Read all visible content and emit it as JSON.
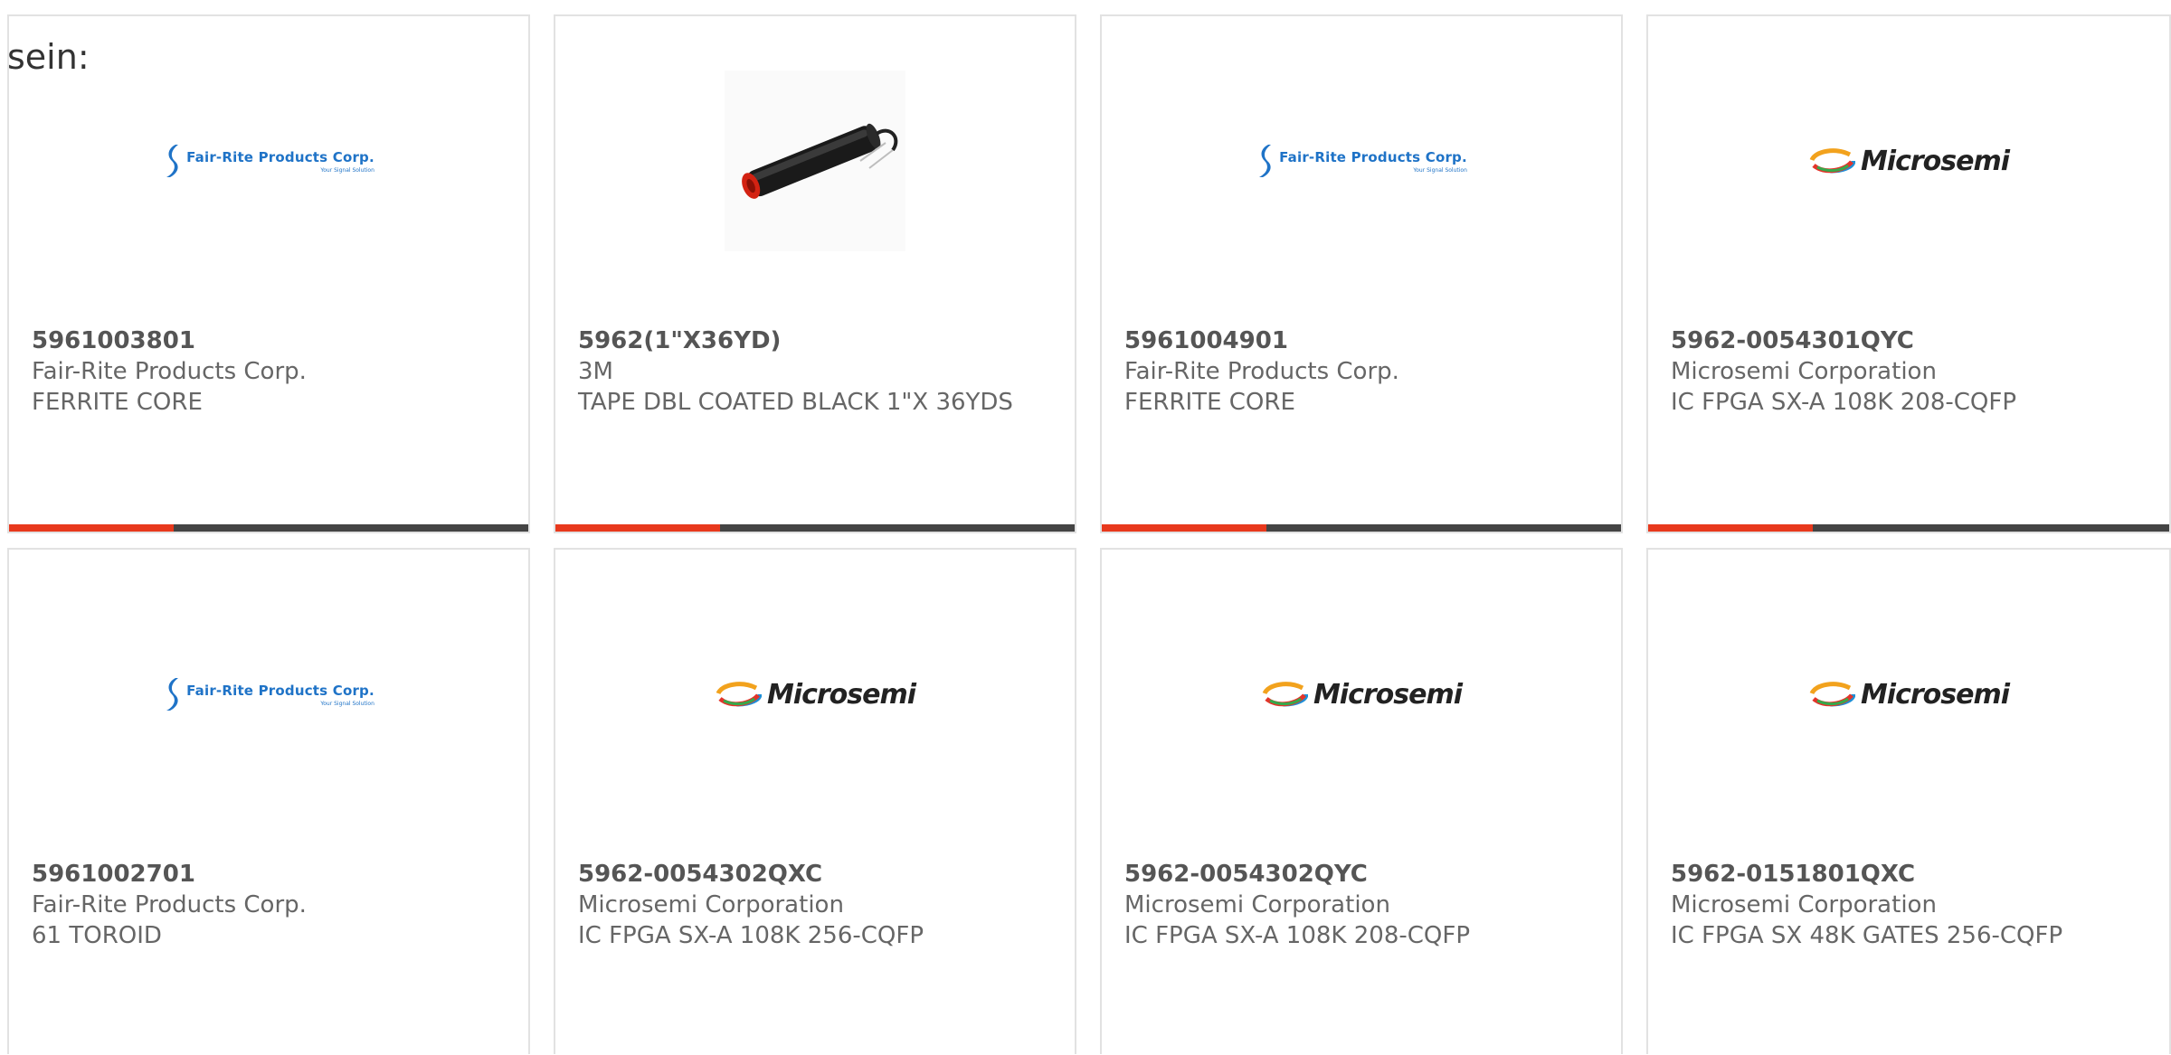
{
  "intro_text": "sein:",
  "colors": {
    "accent": "#e8391d",
    "bar_dark": "#444444",
    "fair_rite_blue": "#1f73c7"
  },
  "logos": {
    "fair_rite": {
      "name": "Fair-Rite Products Corp.",
      "tagline": "Your Signal Solution"
    },
    "microsemi": {
      "name": "Microsemi"
    }
  },
  "products": [
    {
      "part": "5961003801",
      "manufacturer": "Fair-Rite Products Corp.",
      "description": "FERRITE CORE",
      "image": "fair-rite-logo"
    },
    {
      "part": "5962(1\"X36YD)",
      "manufacturer": "3M",
      "description": "TAPE DBL COATED BLACK 1\"X 36YDS",
      "image": "tape-product-photo"
    },
    {
      "part": "5961004901",
      "manufacturer": "Fair-Rite Products Corp.",
      "description": "FERRITE CORE",
      "image": "fair-rite-logo"
    },
    {
      "part": "5962-0054301QYC",
      "manufacturer": "Microsemi Corporation",
      "description": "IC FPGA SX-A 108K 208-CQFP",
      "image": "microsemi-logo"
    },
    {
      "part": "5961002701",
      "manufacturer": "Fair-Rite Products Corp.",
      "description": "61 TOROID",
      "image": "fair-rite-logo"
    },
    {
      "part": "5962-0054302QXC",
      "manufacturer": "Microsemi Corporation",
      "description": "IC FPGA SX-A 108K 256-CQFP",
      "image": "microsemi-logo"
    },
    {
      "part": "5962-0054302QYC",
      "manufacturer": "Microsemi Corporation",
      "description": "IC FPGA SX-A 108K 208-CQFP",
      "image": "microsemi-logo"
    },
    {
      "part": "5962-0151801QXC",
      "manufacturer": "Microsemi Corporation",
      "description": "IC FPGA SX 48K GATES 256-CQFP",
      "image": "microsemi-logo"
    }
  ]
}
